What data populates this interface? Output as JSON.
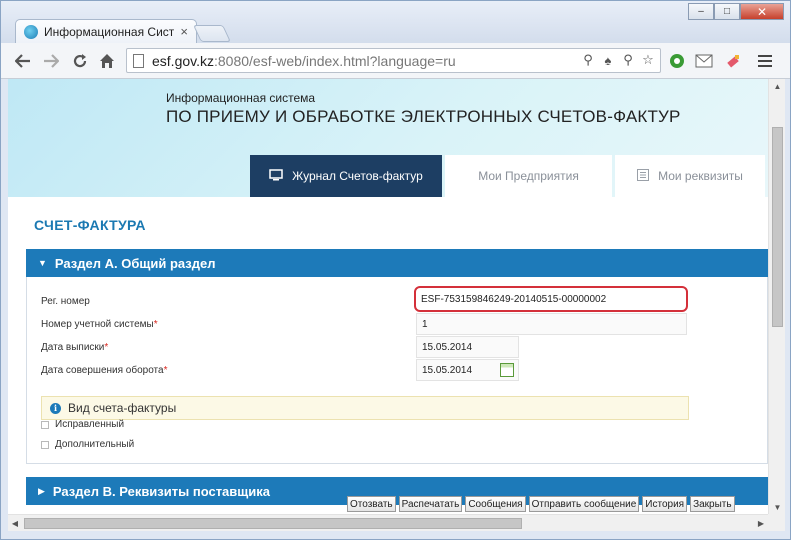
{
  "browser": {
    "tab_title": "Информационная Систе",
    "tab_close": "×",
    "url_host": "esf.gov.kz",
    "url_rest": ":8080/esf-web/index.html?language=ru",
    "window_buttons": {
      "minimize": "–",
      "maximize": "□",
      "close": "✕"
    },
    "icons": {
      "back": "arrow-left",
      "forward": "arrow-right",
      "reload": "reload",
      "home": "home",
      "star": "star",
      "menu": "hamburger"
    }
  },
  "header": {
    "system_small": "Информационная система",
    "system_title": "ПО ПРИЕМУ И ОБРАБОТКЕ ЭЛЕКТРОННЫХ СЧЕТОВ-ФАКТУР"
  },
  "nav": {
    "tabs": [
      {
        "label": "Журнал Счетов-фактур",
        "icon": "monitor-icon",
        "active": true
      },
      {
        "label": "Мои Предприятия",
        "icon": "",
        "active": false
      },
      {
        "label": "Мои реквизиты",
        "icon": "list-icon",
        "active": false
      }
    ]
  },
  "page": {
    "title": "СЧЕТ-ФАКТУРА"
  },
  "section_a": {
    "title": "Раздел А. Общий раздел",
    "fields": {
      "reg_number": {
        "label": "Рег. номер",
        "value": "ESF-753159846249-20140515-00000002"
      },
      "account_number": {
        "label": "Номер учетной системы",
        "value": "1"
      },
      "issue_date": {
        "label": "Дата выписки",
        "value": "15.05.2014"
      },
      "turnover_date": {
        "label": "Дата совершения оборота",
        "value": "15.05.2014"
      }
    },
    "required_mark": "*",
    "invoice_type": {
      "label": "Вид счета-фактуры",
      "info_icon": "i"
    },
    "checkboxes": [
      {
        "label": "Исправленный",
        "checked": false
      },
      {
        "label": "Дополнительный",
        "checked": false
      }
    ]
  },
  "section_b": {
    "title": "Раздел B. Реквизиты поставщика"
  },
  "actions": {
    "revoke": "Отозвать",
    "print": "Распечатать",
    "messages": "Сообщения",
    "send_message": "Отправить сообщение",
    "history": "История",
    "close": "Закрыть"
  },
  "accent_colors": {
    "section_header": "#1d7ab9",
    "active_tab": "#1d3e63",
    "page_title": "#1b79b2",
    "highlight_border": "#d4303a"
  }
}
